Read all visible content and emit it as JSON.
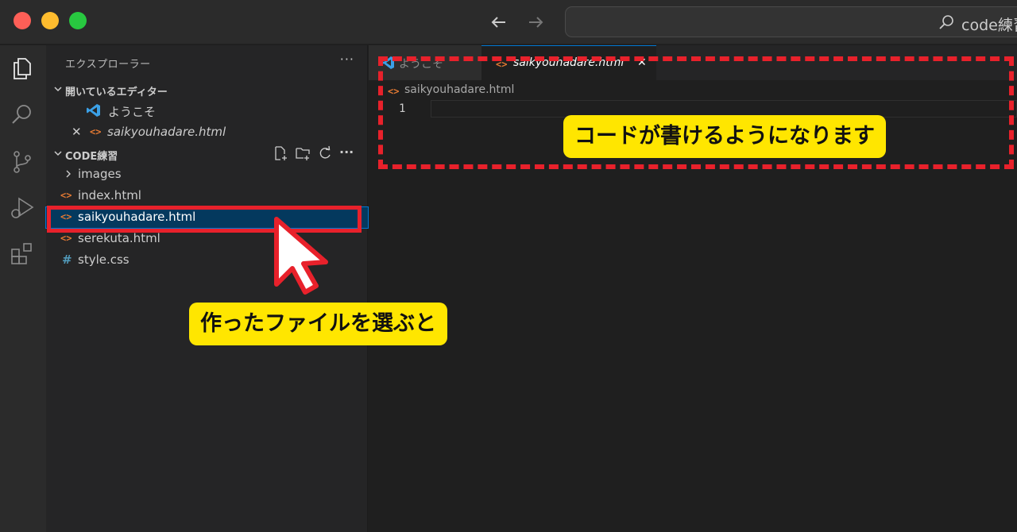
{
  "window": {
    "command_center_text": "code練習"
  },
  "sidebar": {
    "title": "エクスプローラー",
    "more": "···",
    "open_editors": {
      "header": "開いているエディター",
      "items": [
        {
          "label": "ようこそ",
          "icon": "vscode-icon"
        },
        {
          "label": "saikyouhadare.html",
          "icon": "html-icon",
          "close": "✕"
        }
      ]
    },
    "workspace": {
      "header": "CODE練習",
      "items": [
        {
          "label": "images",
          "type": "folder"
        },
        {
          "label": "index.html",
          "type": "html"
        },
        {
          "label": "saikyouhadare.html",
          "type": "html",
          "selected": true
        },
        {
          "label": "serekuta.html",
          "type": "html"
        },
        {
          "label": "style.css",
          "type": "css"
        }
      ]
    }
  },
  "editor": {
    "tabs": [
      {
        "label": "ようこそ",
        "icon": "vscode-icon",
        "active": false
      },
      {
        "label": "saikyouhadare.html",
        "icon": "html-icon",
        "active": true,
        "close": "✕"
      }
    ],
    "breadcrumb": "saikyouhadare.html",
    "line_number": "1"
  },
  "annotations": {
    "editor_callout": "コードが書けるようになります",
    "sidebar_callout": "作ったファイルを選ぶと"
  },
  "icons": {
    "html_glyph": "<>",
    "css_glyph": "#",
    "more_glyph": "···"
  },
  "colors": {
    "accent_red": "#e8212b",
    "callout_yellow": "#ffe600",
    "selection_blue": "#04395e",
    "html_orange": "#e37933",
    "css_blue": "#519aba"
  }
}
